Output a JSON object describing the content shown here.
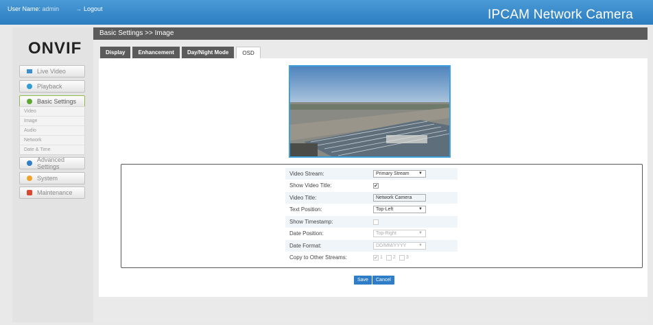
{
  "topbar": {
    "user_label": "User Name:",
    "user_name": "admin",
    "logout_label": "Logout",
    "brand": "IPCAM Network Camera"
  },
  "logo": {
    "text": "ONVIF"
  },
  "sidebar": {
    "items": [
      {
        "label": "Live Video",
        "icon": "live-video-icon"
      },
      {
        "label": "Playback",
        "icon": "playback-icon"
      },
      {
        "label": "Basic Settings",
        "icon": "basic-settings-icon"
      },
      {
        "label": "Advanced Settings",
        "icon": "advanced-settings-icon"
      },
      {
        "label": "System",
        "icon": "system-icon"
      },
      {
        "label": "Maintenance",
        "icon": "maintenance-icon"
      }
    ],
    "sub_items": [
      "Video",
      "Image",
      "Audio",
      "Network",
      "Date & Time"
    ]
  },
  "header": {
    "breadcrumb": "Basic Settings >> Image"
  },
  "tabs": [
    {
      "label": "Display"
    },
    {
      "label": "Enhancement"
    },
    {
      "label": "Day/Night Mode"
    },
    {
      "label": "OSD"
    }
  ],
  "form": {
    "video_stream": {
      "label": "Video Stream:",
      "value": "Primary Stream"
    },
    "show_video_title": {
      "label": "Show Video Title:",
      "checked": true
    },
    "video_title": {
      "label": "Video Title:",
      "value": "Network Camera"
    },
    "text_position": {
      "label": "Text Position:",
      "value": "Top-Left"
    },
    "show_timestamp": {
      "label": "Show Timestamp:",
      "checked": false
    },
    "date_position": {
      "label": "Date Position:",
      "value": "Top-Right"
    },
    "date_format": {
      "label": "Date Format:",
      "value": "DD/MM/YYYY"
    },
    "copy_streams": {
      "label": "Copy to Other Streams:",
      "options": [
        "1",
        "2",
        "3"
      ]
    }
  },
  "buttons": {
    "save": "Save",
    "cancel": "Cancel"
  },
  "colors": {
    "topbar": "#2c7dc0",
    "header": "#5b5b5b",
    "accent": "#2e7dc6",
    "active_nav": "#8dbb4a"
  }
}
